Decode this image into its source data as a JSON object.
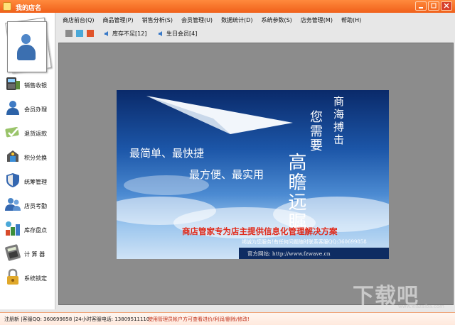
{
  "window": {
    "title": "我的店名"
  },
  "menu": [
    "商店前台(Q)",
    "商品管理(P)",
    "销售分析(S)",
    "会员管理(U)",
    "数据统计(D)",
    "系统参数(S)",
    "店务管理(M)",
    "帮助(H)"
  ],
  "toolbar": {
    "colors": [
      "#8a8a8a",
      "#4aa8d8",
      "#e0542a"
    ],
    "low_stock_label": "库存不足[12]",
    "birthday_label": "生日会员[4]"
  },
  "sidebar": {
    "items": [
      {
        "label": "销售收银",
        "icon": "cash-register-icon"
      },
      {
        "label": "会员办理",
        "icon": "member-icon"
      },
      {
        "label": "退货返款",
        "icon": "return-icon"
      },
      {
        "label": "积分兑换",
        "icon": "points-exchange-icon"
      },
      {
        "label": "统筹管理",
        "icon": "shield-icon"
      },
      {
        "label": "店员考勤",
        "icon": "staff-icon"
      },
      {
        "label": "库存盘点",
        "icon": "inventory-icon"
      },
      {
        "label": "计 算 器",
        "icon": "calculator-icon"
      },
      {
        "label": "系统锁定",
        "icon": "lock-icon"
      }
    ]
  },
  "banner": {
    "slogan1": "最简单、最快捷",
    "slogan2": "最方便、最实用",
    "vertical1": "商海搏击",
    "vertical2": "您需要",
    "vertical3": "高瞻远瞩",
    "tagline": "商店管家专为店主提供信息化管理解决方案",
    "service": "竭诚为您服务!有任何问题随时联系客服QQ:360699858",
    "website": "官方网站: http://www.fzwave.cn"
  },
  "watermark": {
    "text": "下载吧",
    "sub": "www.xiazaiba.com"
  },
  "status": {
    "left": "注册新 |客服QQ: 360699858 |24小时客服电话: 13809511110",
    "right": "使用管理员帐户方可查看进价/利润/删除/修改!"
  }
}
